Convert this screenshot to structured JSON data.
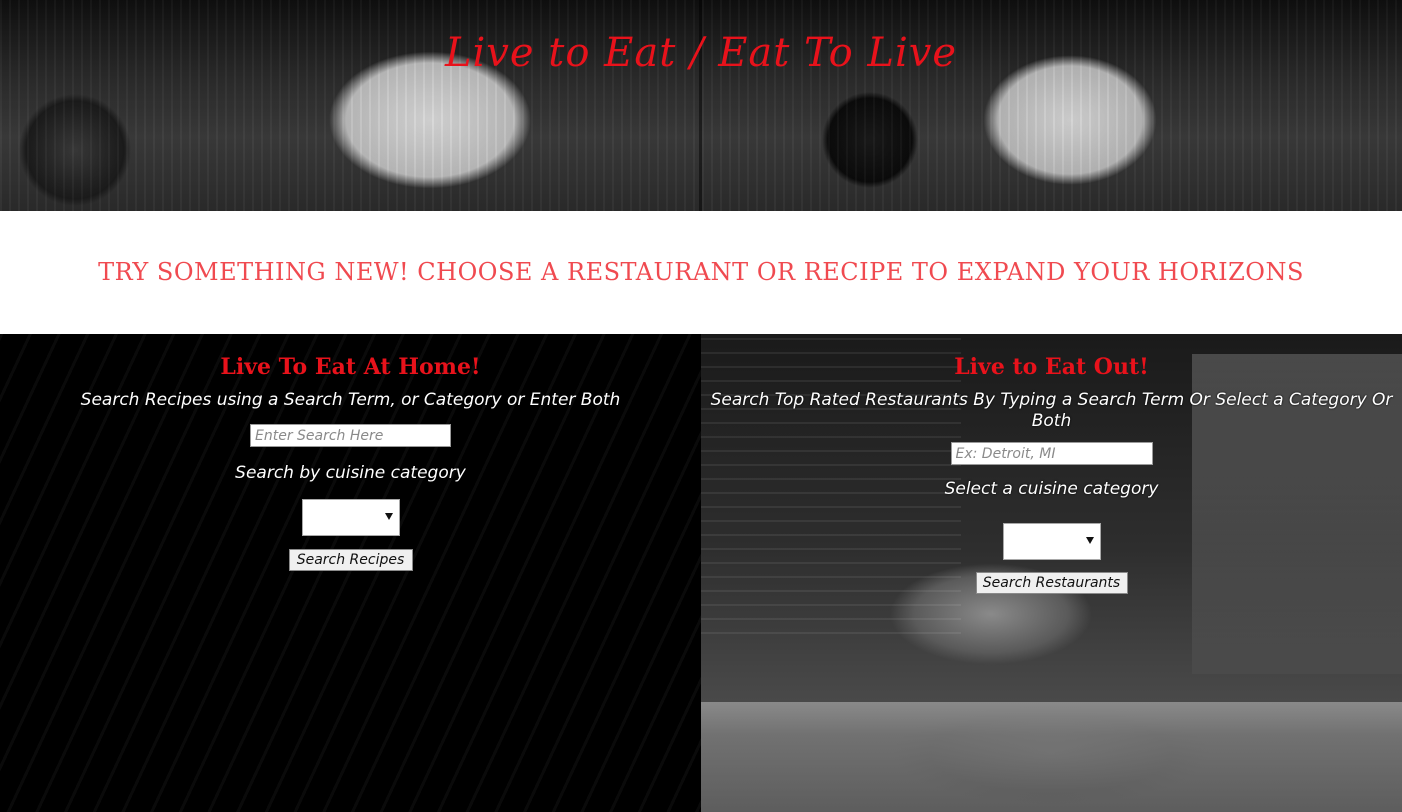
{
  "header": {
    "title": "Live to Eat / Eat To Live"
  },
  "tagline": "TRY SOMETHING NEW! CHOOSE A RESTAURANT OR RECIPE TO EXPAND YOUR HORIZONS",
  "recipes": {
    "heading": "Live To Eat At Home!",
    "description": "Search Recipes using a Search Term, or Category or Enter Both",
    "search_placeholder": "Enter Search Here",
    "search_value": "",
    "category_label": "Search by cuisine category",
    "category_selected": "",
    "button_label": "Search Recipes"
  },
  "restaurants": {
    "heading": "Live to Eat Out!",
    "description": "Search Top Rated Restaurants By Typing a Search Term Or Select a Category Or Both",
    "location_placeholder": "Ex: Detroit, MI",
    "location_value": "",
    "category_label": "Select a cuisine category",
    "category_selected": "",
    "button_label": "Search Restaurants"
  },
  "colors": {
    "accent_red": "#e8121b",
    "tagline_red": "#f04a50"
  },
  "icons": {
    "dropdown_arrow": "chevron-down-icon"
  }
}
